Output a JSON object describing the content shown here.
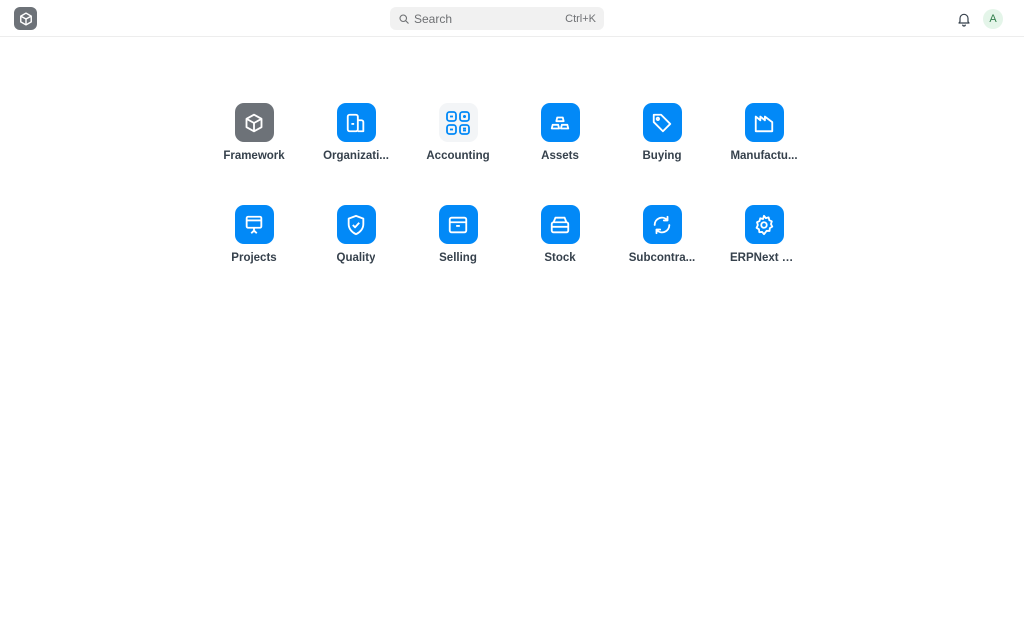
{
  "header": {
    "logo_icon": "cube-icon",
    "search": {
      "placeholder": "Search",
      "shortcut": "Ctrl+K",
      "icon": "search-icon"
    },
    "notifications_icon": "bell-icon",
    "avatar_initial": "A"
  },
  "colors": {
    "accent": "#0289f7",
    "framework_gray": "#6d7278",
    "accounting_bg": "#f3f5f7",
    "avatar_bg": "#e4f5e9",
    "avatar_text": "#317e4b"
  },
  "apps": [
    {
      "label": "Framework",
      "icon": "cube-icon"
    },
    {
      "label": "Organizati...",
      "icon": "organization-icon"
    },
    {
      "label": "Accounting",
      "icon": "accounting-grid-icon"
    },
    {
      "label": "Assets",
      "icon": "assets-icon"
    },
    {
      "label": "Buying",
      "icon": "tag-icon"
    },
    {
      "label": "Manufactu...",
      "icon": "factory-icon"
    },
    {
      "label": "Projects",
      "icon": "presentation-icon"
    },
    {
      "label": "Quality",
      "icon": "shield-check-icon"
    },
    {
      "label": "Selling",
      "icon": "box-icon"
    },
    {
      "label": "Stock",
      "icon": "stock-icon"
    },
    {
      "label": "Subcontra...",
      "icon": "refresh-icon"
    },
    {
      "label": "ERPNext S...",
      "icon": "gear-icon"
    }
  ]
}
